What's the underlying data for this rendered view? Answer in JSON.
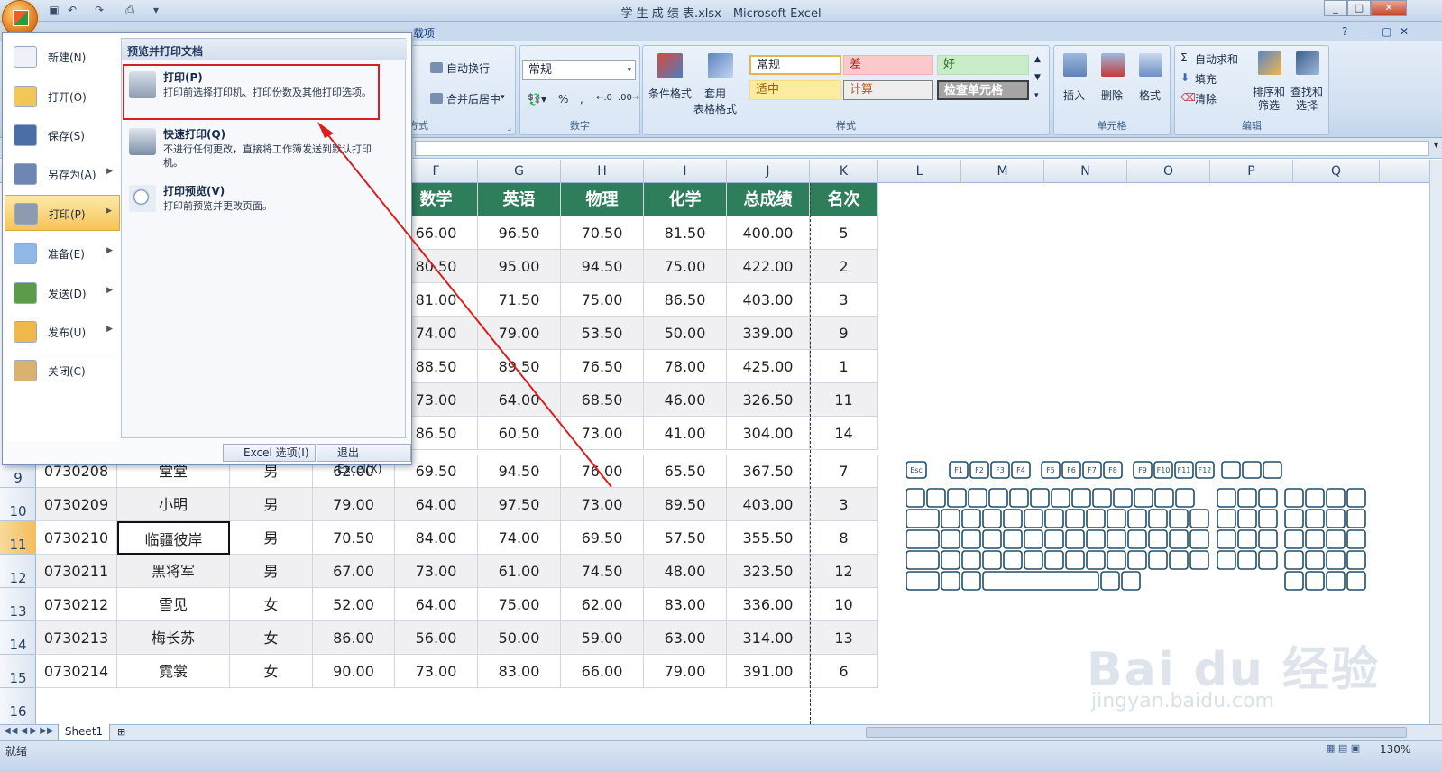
{
  "window": {
    "title": "学 生 成 绩 表.xlsx - Microsoft Excel"
  },
  "ribbon": {
    "tab_addins": "载项",
    "wrap_text": "自动换行",
    "merge_center": "合并后居中",
    "alignment_label": "方式",
    "number_format": "常规",
    "number_label": "数字",
    "conditional_format": "条件格式",
    "format_as_table": "套用\n表格格式",
    "styles": [
      "常规",
      "差",
      "好",
      "适中",
      "计算",
      "检查单元格"
    ],
    "styles_label": "样式",
    "insert": "插入",
    "delete": "删除",
    "format": "格式",
    "cells_label": "单元格",
    "autosum": "自动求和",
    "fill": "填充",
    "clear": "清除",
    "sort_filter": "排序和\n筛选",
    "find_select": "查找和\n选择",
    "editing_label": "编辑"
  },
  "office_menu": {
    "items": [
      {
        "label": "新建(N)",
        "icon": "new-document-icon"
      },
      {
        "label": "打开(O)",
        "icon": "folder-open-icon"
      },
      {
        "label": "保存(S)",
        "icon": "save-disk-icon"
      },
      {
        "label": "另存为(A)",
        "icon": "save-as-icon"
      },
      {
        "label": "打印(P)",
        "icon": "printer-icon"
      },
      {
        "label": "准备(E)",
        "icon": "prepare-icon"
      },
      {
        "label": "发送(D)",
        "icon": "send-icon"
      },
      {
        "label": "发布(U)",
        "icon": "publish-icon"
      },
      {
        "label": "关闭(C)",
        "icon": "close-folder-icon"
      }
    ],
    "submenu_title": "预览并打印文档",
    "options": [
      {
        "title": "打印(P)",
        "desc": "打印前选择打印机、打印份数及其他打印选项。"
      },
      {
        "title": "快速打印(Q)",
        "desc": "不进行任何更改，直接将工作簿发送到默认打印机。"
      },
      {
        "title": "打印预览(V)",
        "desc": "打印前预览并更改页面。"
      }
    ],
    "excel_options": "Excel 选项(I)",
    "exit_excel": "退出 Excel(X)"
  },
  "sheet": {
    "columns": [
      "F",
      "G",
      "H",
      "I",
      "J",
      "K",
      "L",
      "M",
      "N",
      "O",
      "P",
      "Q"
    ],
    "headers": [
      "数学",
      "英语",
      "物理",
      "化学",
      "总成绩",
      "名次"
    ],
    "upper_rows": [
      [
        "66.00",
        "96.50",
        "70.50",
        "81.50",
        "400.00",
        "5"
      ],
      [
        "80.50",
        "95.00",
        "94.50",
        "75.00",
        "422.00",
        "2"
      ],
      [
        "81.00",
        "71.50",
        "75.00",
        "86.50",
        "403.00",
        "3"
      ],
      [
        "74.00",
        "79.00",
        "53.50",
        "50.00",
        "339.00",
        "9"
      ],
      [
        "88.50",
        "89.50",
        "76.50",
        "78.00",
        "425.00",
        "1"
      ],
      [
        "73.00",
        "64.00",
        "68.50",
        "46.00",
        "326.50",
        "11"
      ],
      [
        "86.50",
        "60.50",
        "73.00",
        "41.00",
        "304.00",
        "14"
      ]
    ],
    "row_numbers": [
      "9",
      "10",
      "11",
      "12",
      "13",
      "14",
      "15",
      "16"
    ],
    "lower_rows": [
      [
        "0730208",
        "堂堂",
        "男",
        "62.00",
        "69.50",
        "94.50",
        "76.00",
        "65.50",
        "367.50",
        "7"
      ],
      [
        "0730209",
        "小明",
        "男",
        "79.00",
        "64.00",
        "97.50",
        "73.00",
        "89.50",
        "403.00",
        "3"
      ],
      [
        "0730210",
        "临疆彼岸",
        "男",
        "70.50",
        "84.00",
        "74.00",
        "69.50",
        "57.50",
        "355.50",
        "8"
      ],
      [
        "0730211",
        "黑将军",
        "男",
        "67.00",
        "73.00",
        "61.00",
        "74.50",
        "48.00",
        "323.50",
        "12"
      ],
      [
        "0730212",
        "雪见",
        "女",
        "52.00",
        "64.00",
        "75.00",
        "62.00",
        "83.00",
        "336.00",
        "10"
      ],
      [
        "0730213",
        "梅长苏",
        "女",
        "86.00",
        "56.00",
        "50.00",
        "59.00",
        "63.00",
        "314.00",
        "13"
      ],
      [
        "0730214",
        "霓裳",
        "女",
        "90.00",
        "73.00",
        "83.00",
        "66.00",
        "79.00",
        "391.00",
        "6"
      ]
    ],
    "sheet_tab": "Sheet1"
  },
  "status": {
    "ready": "就绪",
    "zoom": "130%"
  },
  "watermark": {
    "line1": "Bai du 经验",
    "line2": "jingyan.baidu.com"
  },
  "colors": {
    "header_green": "#2e7d5b",
    "highlight_red": "#d81f1f"
  }
}
